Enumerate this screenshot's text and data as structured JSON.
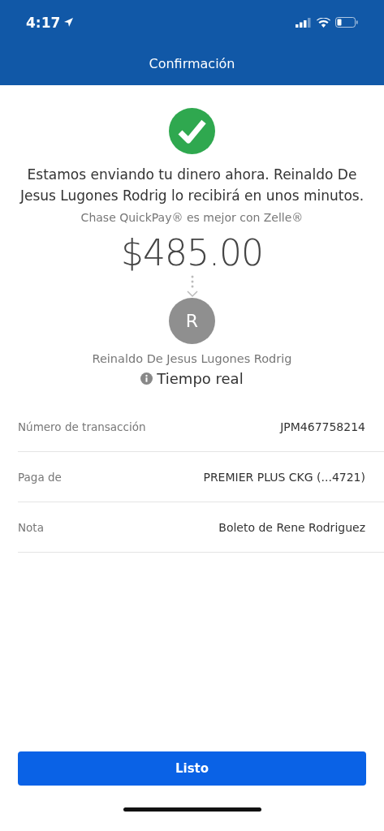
{
  "status_bar": {
    "time": "4:17"
  },
  "header": {
    "title": "Confirmación"
  },
  "message": "Estamos enviando tu dinero ahora. Reinaldo De Jesus Lugones Rodrig lo recibirá en unos minutos.",
  "tagline": "Chase QuickPay® es mejor con Zelle®",
  "amount": "$485.00",
  "recipient": {
    "initial": "R",
    "name": "Reinaldo De Jesus Lugones Rodrig"
  },
  "speed": "Tiempo real",
  "details": [
    {
      "label": "Número de transacción",
      "value": "JPM467758214"
    },
    {
      "label": "Paga de",
      "value": "PREMIER PLUS CKG (...4721)"
    },
    {
      "label": "Nota",
      "value": "Boleto de Rene Rodriguez"
    }
  ],
  "button": "Listo"
}
